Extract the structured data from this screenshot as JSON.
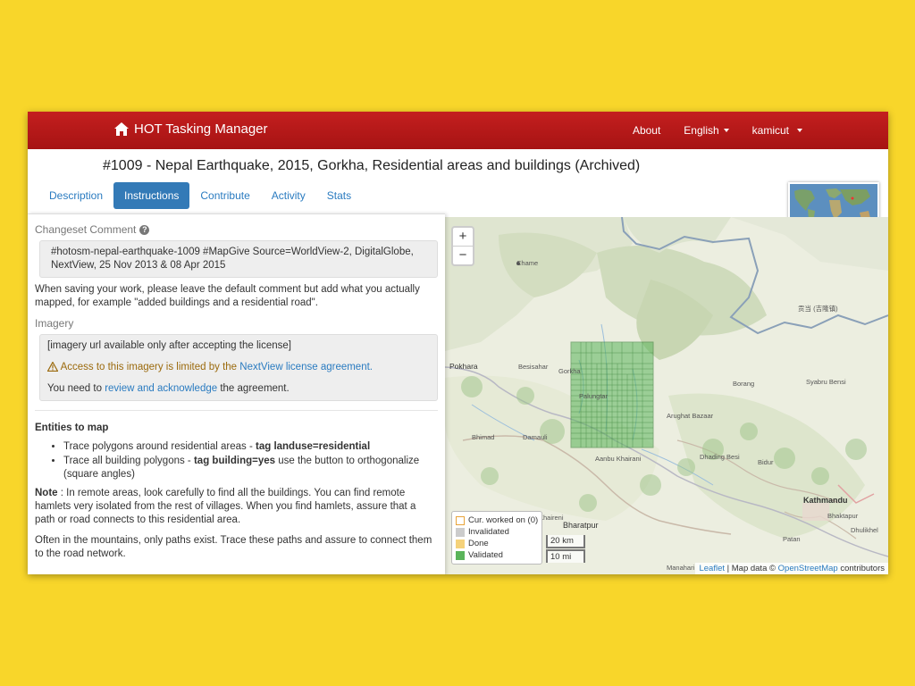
{
  "navbar": {
    "brand": "HOT Tasking Manager",
    "about": "About",
    "language": "English",
    "user": "kamicut"
  },
  "project": {
    "title": "#1009 - Nepal Earthquake, 2015, Gorkha, Residential areas and buildings (Archived)"
  },
  "tabs": [
    {
      "label": "Description"
    },
    {
      "label": "Instructions"
    },
    {
      "label": "Contribute"
    },
    {
      "label": "Activity"
    },
    {
      "label": "Stats"
    }
  ],
  "instructions": {
    "changeset_label": "Changeset Comment",
    "changeset_comment": "#hotosm-nepal-earthquake-1009 #MapGive Source=WorldView-2, DigitalGlobe, NextView, 25 Nov 2013 & 08 Apr 2015",
    "changeset_hint": "When saving your work, please leave the default comment but add what you actually mapped, for example \"added buildings and a residential road\".",
    "imagery_label": "Imagery",
    "imagery_url_note": "[imagery url available only after accepting the license]",
    "imagery_warning_prefix": "Access to this imagery is limited by the",
    "imagery_warning_link": "NextView license agreement.",
    "need_prefix": "You need to",
    "need_link": "review and acknowledge",
    "need_suffix": "the agreement.",
    "entities_heading": "Entities to map",
    "entity_1_prefix": "Trace polygons around residential areas - ",
    "entity_1_bold": "tag landuse=residential",
    "entity_2_prefix": "Trace all building polygons - ",
    "entity_2_bold": "tag building=yes",
    "entity_2_suffix": " use the button to orthogonalize (square angles)",
    "note_bold": "Note",
    "note_text": " : In remote areas, look carefully to find all the buildings. You can find remote hamlets very isolated from the rest of villages. When you find hamlets, assure that a path or road connects to this residential area.",
    "mountains_text": "Often in the mountains, only paths exist. Trace these paths and assure to connect them to the road network."
  },
  "map": {
    "zoom_in": "+",
    "zoom_out": "−",
    "legend": {
      "cur_worked": "Cur. worked on (0)",
      "invalidated": "Invalidated",
      "done": "Done",
      "validated": "Validated"
    },
    "scale_km": "20 km",
    "scale_mi": "10 mi",
    "attribution_leaflet": "Leaflet",
    "attribution_text": " | Map data © ",
    "attribution_osm": "OpenStreetMap",
    "attribution_suffix": " contributors",
    "colors": {
      "cur_worked": "#ffffff",
      "invalidated": "#cccccc",
      "done": "#f5d27a",
      "validated": "#5ab45a"
    },
    "places": {
      "chame": "Chame",
      "pokhara": "Pokhara",
      "besisahar": "Besisahar",
      "gaurishankar": "贡当 (吉隆镇)",
      "borang": "Borang",
      "syabru": "Syabru Bensi",
      "arughat": "Arughat Bazaar",
      "bhimad": "Bhimad",
      "damauli": "Damauli",
      "aanbu": "Aanbu Khairani",
      "dhading": "Dhading Besi",
      "bidur": "Bidur",
      "bharatpur": "Bharatpur",
      "kathmandu": "Kathmandu",
      "bhaktapur": "Bhaktapur",
      "patan": "Patan",
      "manahari": "Manahari",
      "palungtar": "Palungtar",
      "gorkha": "Gorkha",
      "khairenitar": "Khaireni",
      "dhulikhel": "Dhulikhel"
    }
  }
}
